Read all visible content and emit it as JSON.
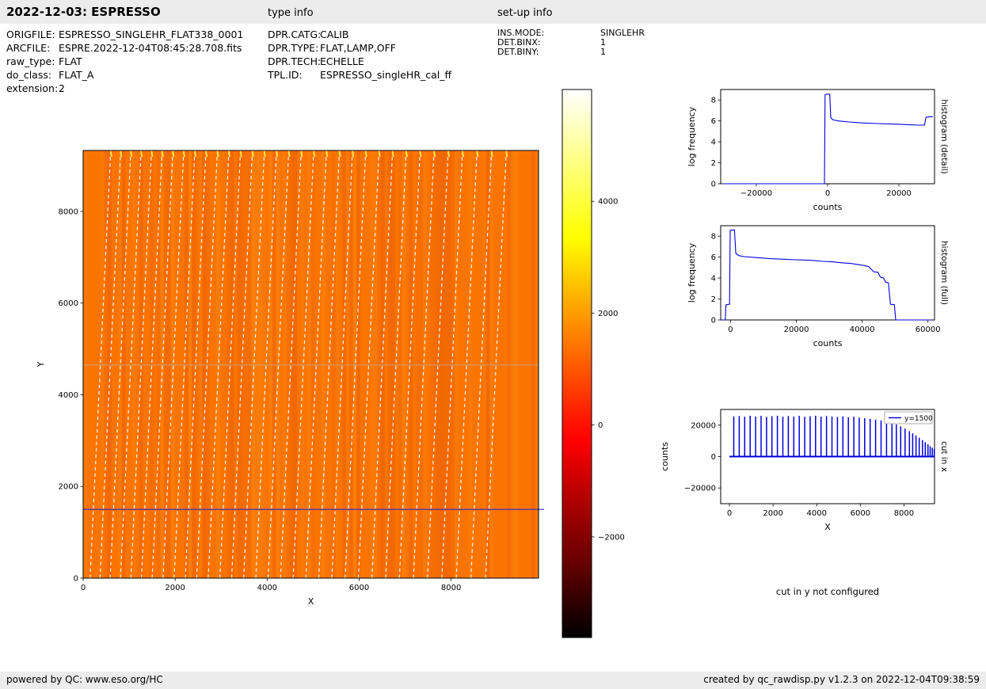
{
  "header": {
    "title": "2022-12-03: ESPRESSO",
    "type_info": "type info",
    "setup_info": "set-up info"
  },
  "metadata": {
    "file": [
      {
        "label": "ORIGFILE:",
        "value": "ESPRESSO_SINGLEHR_FLAT338_0001"
      },
      {
        "label": "ARCFILE:",
        "value": "ESPRE.2022-12-04T08:45:28.708.fits"
      },
      {
        "label": "raw_type:",
        "value": "FLAT"
      },
      {
        "label": "do_class:",
        "value": "FLAT_A"
      },
      {
        "label": "extension:",
        "value": "2"
      }
    ],
    "type_info": [
      {
        "label": "DPR.CATG:",
        "value": "CALIB"
      },
      {
        "label": "DPR.TYPE:",
        "value": "FLAT,LAMP,OFF"
      },
      {
        "label": "DPR.TECH:",
        "value": "ECHELLE"
      },
      {
        "label": "TPL.ID:",
        "value": "ESPRESSO_singleHR_cal_ff"
      }
    ],
    "setup_info": [
      {
        "label": "INS.MODE:",
        "value": "SINGLEHR"
      },
      {
        "label": "DET.BINX:",
        "value": "1"
      },
      {
        "label": "DET.BINY:",
        "value": "1"
      }
    ]
  },
  "messages": {
    "cut_y": "cut in y not configured"
  },
  "footer": {
    "left": "powered by QC: www.eso.org/HC",
    "right": "created by qc_rawdisp.py v1.2.3 on 2022-12-04T09:38:59"
  },
  "chart_data": [
    {
      "id": "raw-image-display",
      "type": "heatmap",
      "title": "",
      "xlabel": "X",
      "ylabel": "Y",
      "xlim": [
        0,
        9900
      ],
      "ylim": [
        0,
        9330
      ],
      "xticks": [
        0,
        2000,
        4000,
        6000,
        8000
      ],
      "yticks": [
        0,
        2000,
        4000,
        6000,
        8000
      ],
      "base_color": "#fa7405",
      "traces": {
        "count": 33,
        "x_start": 150,
        "x_end": 8750,
        "tilt": 450,
        "spread": 0.25,
        "color": "#ffffff"
      },
      "cut_line": {
        "y": 1500,
        "color": "#2a2ad4"
      },
      "faint_line_y": 4650,
      "colorbar": {
        "ticks": [
          4000,
          2000,
          0,
          -2000
        ],
        "vmin": -3800,
        "vmax": 6000,
        "colormap": "hot",
        "stops": [
          [
            "0%",
            "#ffffff"
          ],
          [
            "10%",
            "#ffffa1"
          ],
          [
            "20%",
            "#ffff42"
          ],
          [
            "27%",
            "#ffff00"
          ],
          [
            "40%",
            "#ffa300"
          ],
          [
            "50%",
            "#ff5e00"
          ],
          [
            "60%",
            "#ff1800"
          ],
          [
            "64%",
            "#ff0000"
          ],
          [
            "75%",
            "#af0000"
          ],
          [
            "86%",
            "#690000"
          ],
          [
            "100%",
            "#000000"
          ]
        ]
      }
    },
    {
      "id": "histogram-detail",
      "type": "line",
      "xlabel": "counts",
      "ylabel": "log frequency",
      "side_label": "histogram (detail)",
      "xlim": [
        -30000,
        30000
      ],
      "ylim": [
        0,
        9
      ],
      "xticks": [
        -20000,
        0,
        20000
      ],
      "yticks": [
        0,
        2,
        4,
        6,
        8
      ],
      "color": "#0000dd",
      "points": [
        [
          -29500,
          0
        ],
        [
          -900,
          0
        ],
        [
          -700,
          8.5
        ],
        [
          -200,
          8.55
        ],
        [
          600,
          8.55
        ],
        [
          900,
          6.3
        ],
        [
          1500,
          6.1
        ],
        [
          3000,
          6.0
        ],
        [
          6000,
          5.9
        ],
        [
          10000,
          5.8
        ],
        [
          14000,
          5.75
        ],
        [
          18000,
          5.7
        ],
        [
          22000,
          5.65
        ],
        [
          25500,
          5.6
        ],
        [
          27200,
          5.6
        ],
        [
          27600,
          6.35
        ],
        [
          28600,
          6.4
        ],
        [
          29500,
          6.4
        ]
      ]
    },
    {
      "id": "histogram-full",
      "type": "line",
      "xlabel": "counts",
      "ylabel": "log frequency",
      "side_label": "histogram (full)",
      "xlim": [
        -3000,
        62000
      ],
      "ylim": [
        0,
        9
      ],
      "xticks": [
        0,
        20000,
        40000,
        60000
      ],
      "yticks": [
        0,
        2,
        4,
        6,
        8
      ],
      "color": "#0000dd",
      "points": [
        [
          -2800,
          0
        ],
        [
          -1600,
          0
        ],
        [
          -1400,
          1.45
        ],
        [
          -300,
          1.5
        ],
        [
          -100,
          8.55
        ],
        [
          1200,
          8.6
        ],
        [
          1600,
          6.35
        ],
        [
          2500,
          6.15
        ],
        [
          4000,
          6.05
        ],
        [
          8000,
          5.95
        ],
        [
          12000,
          5.85
        ],
        [
          16000,
          5.8
        ],
        [
          20000,
          5.75
        ],
        [
          24000,
          5.7
        ],
        [
          28000,
          5.6
        ],
        [
          31000,
          5.55
        ],
        [
          34000,
          5.45
        ],
        [
          36500,
          5.4
        ],
        [
          38500,
          5.3
        ],
        [
          40500,
          5.2
        ],
        [
          42000,
          5.1
        ],
        [
          43500,
          4.6
        ],
        [
          44800,
          4.55
        ],
        [
          45500,
          4.1
        ],
        [
          46500,
          4.0
        ],
        [
          47200,
          3.6
        ],
        [
          48000,
          3.55
        ],
        [
          48600,
          1.5
        ],
        [
          49800,
          1.45
        ],
        [
          50200,
          0
        ],
        [
          61000,
          0
        ]
      ]
    },
    {
      "id": "cut-in-x",
      "type": "line",
      "style": "stem",
      "xlabel": "X",
      "ylabel": "counts",
      "side_label": "cut in x",
      "legend": "y=1500",
      "legend_position": "upper right",
      "xlim": [
        -400,
        9400
      ],
      "ylim": [
        -30000,
        30000
      ],
      "xticks": [
        0,
        2000,
        4000,
        6000,
        8000
      ],
      "yticks": [
        -20000,
        0,
        20000
      ],
      "color": "#0000dd",
      "baseline": [
        0,
        9400
      ],
      "spikes": [
        [
          200,
          25600
        ],
        [
          450,
          25800
        ],
        [
          700,
          25400
        ],
        [
          950,
          26000
        ],
        [
          1200,
          25500
        ],
        [
          1450,
          25900
        ],
        [
          1700,
          25300
        ],
        [
          1950,
          25700
        ],
        [
          2200,
          26000
        ],
        [
          2450,
          25400
        ],
        [
          2700,
          25800
        ],
        [
          2950,
          25500
        ],
        [
          3200,
          25900
        ],
        [
          3450,
          25300
        ],
        [
          3700,
          25700
        ],
        [
          3950,
          26000
        ],
        [
          4200,
          25400
        ],
        [
          4450,
          25800
        ],
        [
          4700,
          25500
        ],
        [
          4950,
          25200
        ],
        [
          5200,
          25600
        ],
        [
          5450,
          25100
        ],
        [
          5700,
          25400
        ],
        [
          5950,
          24800
        ],
        [
          6200,
          24400
        ],
        [
          6450,
          24000
        ],
        [
          6700,
          23500
        ],
        [
          6950,
          23000
        ],
        [
          7200,
          22400
        ],
        [
          7450,
          21500
        ],
        [
          7650,
          20400
        ],
        [
          7850,
          19200
        ],
        [
          8050,
          17800
        ],
        [
          8250,
          16200
        ],
        [
          8400,
          14800
        ],
        [
          8550,
          13400
        ],
        [
          8700,
          12000
        ],
        [
          8850,
          10500
        ],
        [
          8975,
          9200
        ],
        [
          9100,
          7800
        ],
        [
          9200,
          6600
        ],
        [
          9300,
          5600
        ],
        [
          9390,
          4800
        ]
      ]
    }
  ]
}
